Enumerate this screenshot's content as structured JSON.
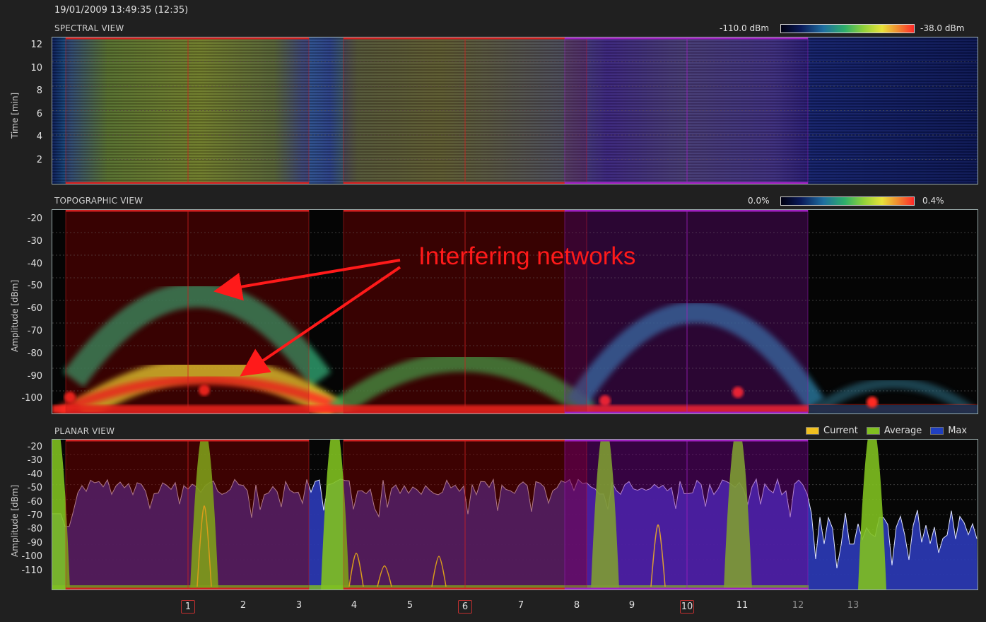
{
  "timestamp": "19/01/2009 13:49:35 (12:35)",
  "spectral": {
    "title": "SPECTRAL VIEW",
    "ylabel": "Time [min]",
    "yticks": [
      "12",
      "10",
      "8",
      "6",
      "4",
      "2"
    ],
    "scale_min": "-110.0 dBm",
    "scale_max": "-38.0 dBm"
  },
  "topographic": {
    "title": "TOPOGRAPHIC VIEW",
    "ylabel": "Amplitude [dBm]",
    "yticks": [
      "-20",
      "-30",
      "-40",
      "-50",
      "-60",
      "-70",
      "-80",
      "-90",
      "-100"
    ],
    "scale_min": "0.0%",
    "scale_max": "0.4%"
  },
  "planar": {
    "title": "PLANAR VIEW",
    "ylabel": "Amplitude [dBm]",
    "yticks": [
      "-20",
      "-30",
      "-40",
      "-50",
      "-60",
      "-70",
      "-80",
      "-90",
      "-100",
      "-110"
    ],
    "legend": [
      {
        "label": "Current",
        "color": "#f0c020"
      },
      {
        "label": "Average",
        "color": "#80c020"
      },
      {
        "label": "Max",
        "color": "#2040c0"
      }
    ]
  },
  "channels": [
    {
      "label": "1",
      "boxed": true,
      "dim": false
    },
    {
      "label": "2",
      "boxed": false,
      "dim": false
    },
    {
      "label": "3",
      "boxed": false,
      "dim": false
    },
    {
      "label": "4",
      "boxed": false,
      "dim": false
    },
    {
      "label": "5",
      "boxed": false,
      "dim": false
    },
    {
      "label": "6",
      "boxed": true,
      "dim": false
    },
    {
      "label": "7",
      "boxed": false,
      "dim": false
    },
    {
      "label": "8",
      "boxed": false,
      "dim": false
    },
    {
      "label": "9",
      "boxed": false,
      "dim": false
    },
    {
      "label": "10",
      "boxed": true,
      "dim": false
    },
    {
      "label": "11",
      "boxed": false,
      "dim": false
    },
    {
      "label": "12",
      "boxed": false,
      "dim": true
    },
    {
      "label": "13",
      "boxed": false,
      "dim": true
    }
  ],
  "annotation": "Interfering networks",
  "colors": {
    "network_red": "#d02020",
    "network_purple": "#a020c0",
    "max_fill": "#2a38b0",
    "annotation": "#ff1a1a"
  }
}
